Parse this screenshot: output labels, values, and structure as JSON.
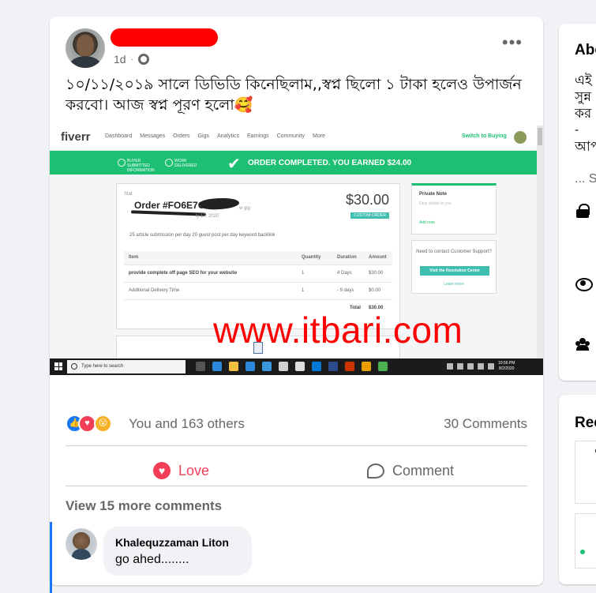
{
  "post": {
    "time": "1d",
    "text": "১০/১১/২০১৯ সালে ডিভিডি কিনেছিলাম,,স্বপ্ন ছিলো ১ টাকা হলেও উপার্জন করবো। আজ স্বপ্ন পূরণ হলো🥰",
    "image": {
      "logo": "fiverr",
      "nav": [
        "Dashboard",
        "Messages",
        "Orders",
        "Gigs",
        "Analytics",
        "Earnings",
        "Community",
        "More"
      ],
      "switch": "Switch to Buying",
      "steps": [
        "BUYER SUBMITTED INFORMATION",
        "WORK DELIVERED"
      ],
      "banner": "ORDER COMPLETED. YOU EARNED $24.00",
      "order_label": "Order #FO6E7C92",
      "order_prefix": "Stat",
      "order_date": "ly 17, 2020",
      "order_extra": "w gig",
      "price": "$30.00",
      "badge": "CUSTOM ORDER",
      "description": "25 article submission per day 20 guest post per day keyword backlink",
      "table": {
        "headers": [
          "Item",
          "Quantity",
          "Duration",
          "Amount"
        ],
        "rows": [
          [
            "provide complete off page SEO for your website",
            "1",
            "4 Days",
            "$30.00"
          ],
          [
            "Additional Delivery Time",
            "1",
            "- 9 days",
            "$0.00"
          ]
        ],
        "total_label": "Total",
        "total_value": "$30.00"
      },
      "note_title": "Private Note",
      "note_sub": "Only visible to you",
      "note_add": "Add note",
      "help_text": "Need to contact Customer Support?",
      "help_button": "Visit the Resolution Center",
      "help_link": "Learn more",
      "watermark": "www.itbari.com",
      "taskbar_search": "Type here to search",
      "clock_time": "10:56 PM",
      "clock_date": "8/2/2020"
    },
    "reactions_text": "You and 163 others",
    "comments_count": "30 Comments",
    "love_label": "Love",
    "comment_label": "Comment",
    "view_more": "View 15 more comments",
    "comment": {
      "name": "Khalequzzaman Liton",
      "text": "go ahed........"
    }
  },
  "sidebar": {
    "about_title": "Abo",
    "about_lines": [
      "এই",
      "সুন্ন",
      "কর",
      "-",
      "আপ"
    ],
    "ellipsis": "... S",
    "recent_title": "Rec"
  },
  "colors": {
    "fiverr_green": "#1dbf73",
    "love_red": "#f33e58",
    "like_blue": "#1877f2"
  }
}
